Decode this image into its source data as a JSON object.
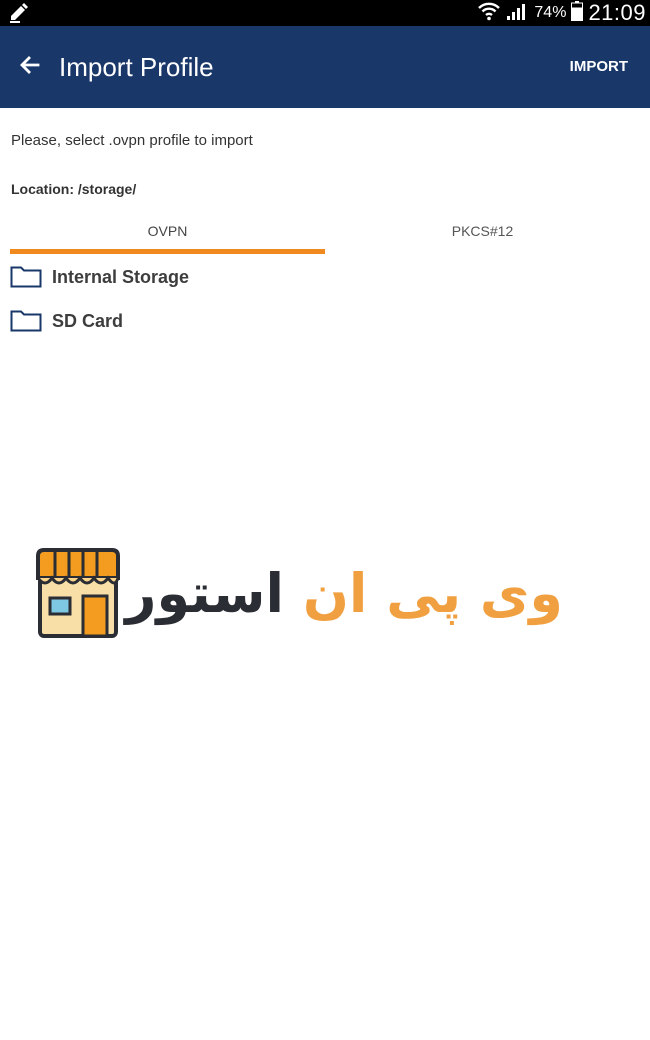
{
  "status_bar": {
    "battery": "74%",
    "time": "21:09",
    "icons": [
      "pencil-icon",
      "wifi-icon",
      "signal-icon",
      "battery-icon"
    ]
  },
  "app_bar": {
    "back_icon": "arrow-left-icon",
    "title": "Import Profile",
    "action_label": "IMPORT",
    "background_color": "#1a3769"
  },
  "content": {
    "instruction": "Please, select .ovpn profile to import",
    "location": "Location: /storage/",
    "tabs": [
      {
        "label": "OVPN",
        "selected": true
      },
      {
        "label": "PKCS#12",
        "selected": false
      }
    ],
    "indicator_color": "#f08a1f",
    "folders": [
      {
        "label": "Internal Storage",
        "icon": "folder-icon"
      },
      {
        "label": "SD Card",
        "icon": "folder-icon"
      }
    ]
  },
  "watermark": {
    "text_orange": "وی پی ان",
    "text_dark": "استور",
    "logo_icon": "storefront-icon"
  }
}
